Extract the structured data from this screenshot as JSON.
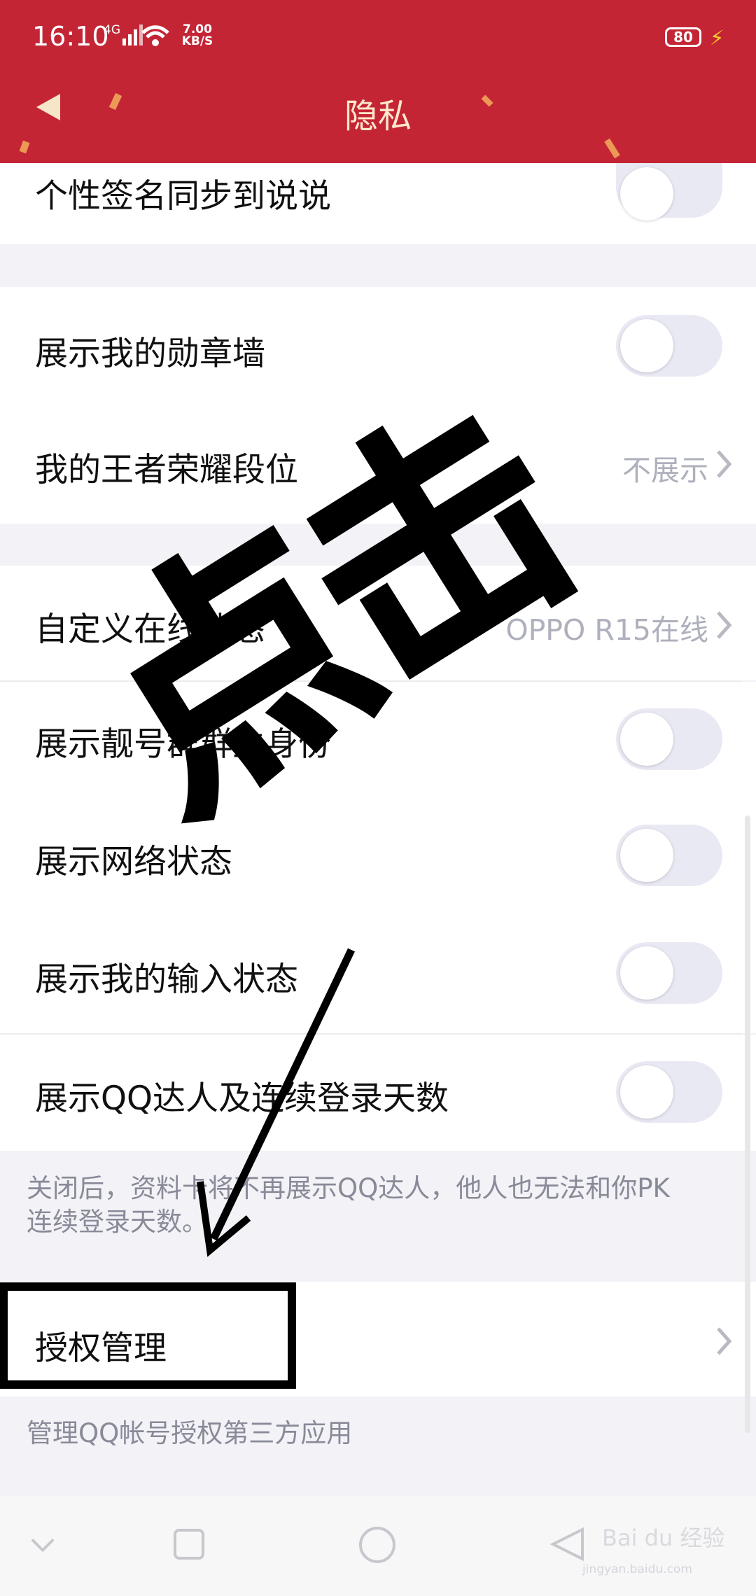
{
  "status_bar": {
    "time": "16:10",
    "network_label": "4G",
    "speed_line1": "7.00",
    "speed_line2": "KB/S",
    "battery_level": "80",
    "icons": [
      "signal-icon",
      "wifi-icon",
      "battery-icon",
      "charging-icon"
    ]
  },
  "header": {
    "title": "隐私",
    "back_icon": "back-arrow-icon",
    "background_color": "#c42535"
  },
  "rows": {
    "signature_sync": {
      "label": "个性签名同步到说说",
      "toggle_on": false
    },
    "medal_wall": {
      "label": "展示我的勋章墙",
      "toggle_on": false
    },
    "honor_rank": {
      "label": "我的王者荣耀段位",
      "value": "不展示"
    },
    "online_status": {
      "label": "自定义在线状态",
      "value": "OPPO R15在线"
    },
    "pretty_number": {
      "label": "展示靓号群群主身份",
      "toggle_on": false
    },
    "network_status": {
      "label": "展示网络状态",
      "toggle_on": false
    },
    "input_status": {
      "label": "展示我的输入状态",
      "toggle_on": false
    },
    "qq_expert": {
      "label": "展示QQ达人及连续登录天数",
      "toggle_on": false
    },
    "auth_manage": {
      "label": "授权管理"
    }
  },
  "notes": {
    "qq_expert_line1": "关闭后，资料卡将不再展示QQ达人，他人也无法和你PK",
    "qq_expert_line2": "连续登录天数。",
    "auth_manage": "管理QQ帐号授权第三方应用"
  },
  "annotation": {
    "text": "点击",
    "color": "#000000"
  },
  "nav_bar": {
    "icons": [
      "nav-down-icon",
      "recent-apps-icon",
      "home-icon",
      "back-icon"
    ]
  },
  "watermark": {
    "main": "Bai du 经验",
    "sub": "jingyan.baidu.com"
  }
}
